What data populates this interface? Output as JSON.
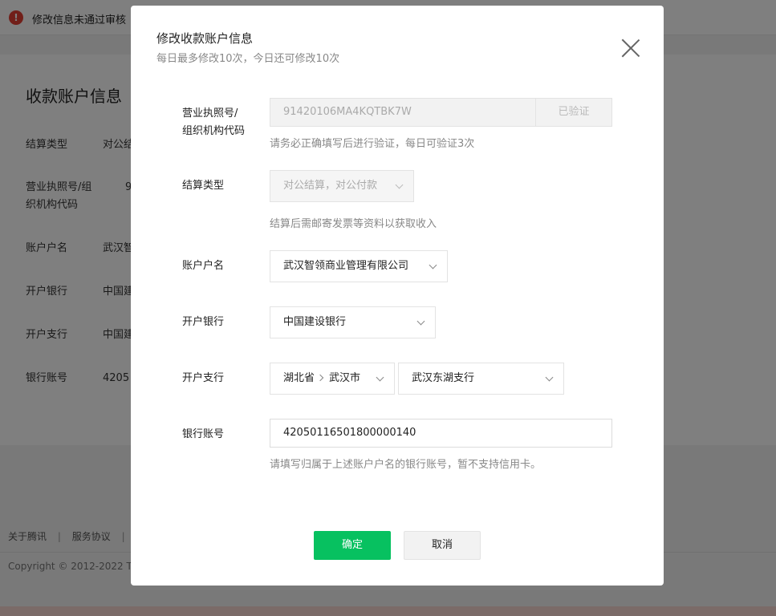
{
  "background": {
    "alert_text": "修改信息未通过审核",
    "section_title": "收款账户信息",
    "rows": [
      {
        "label": "结算类型",
        "value": "对公结"
      },
      {
        "label": "营业执照号/组织机构代码",
        "value": "9"
      },
      {
        "label": "账户户名",
        "value": "武汉智"
      },
      {
        "label": "开户银行",
        "value": "中国建"
      },
      {
        "label": "开户支行",
        "value": "中国建"
      },
      {
        "label": "银行账号",
        "value": "4205"
      }
    ],
    "footer_links": [
      "关于腾讯",
      "服务协议"
    ],
    "copyright": "Copyright © 2012-2022 Te"
  },
  "modal": {
    "title": "修改收款账户信息",
    "subtitle": "每日最多修改10次，今日还可修改10次",
    "license": {
      "label_line1": "营业执照号/",
      "label_line2": "组织机构代码",
      "value": "91420106MA4KQTBK7W",
      "verify_label": "已验证",
      "hint": "请务必正确填写后进行验证，每日可验证3次"
    },
    "settlement": {
      "label": "结算类型",
      "value": "对公结算，对公付款",
      "hint": "结算后需邮寄发票等资料以获取收入"
    },
    "account_name": {
      "label": "账户户名",
      "value": "武汉智领商业管理有限公司"
    },
    "bank": {
      "label": "开户银行",
      "value": "中国建设银行"
    },
    "branch": {
      "label": "开户支行",
      "province": "湖北省",
      "city": "武汉市",
      "branch_value": "武汉东湖支行"
    },
    "account_number": {
      "label": "银行账号",
      "value": "42050116501800000140",
      "hint": "请填写归属于上述账户户名的银行账号，暂不支持信用卡。"
    },
    "ok_label": "确定",
    "cancel_label": "取消"
  },
  "colors": {
    "primary": "#07c160",
    "alert": "#e33e33"
  }
}
